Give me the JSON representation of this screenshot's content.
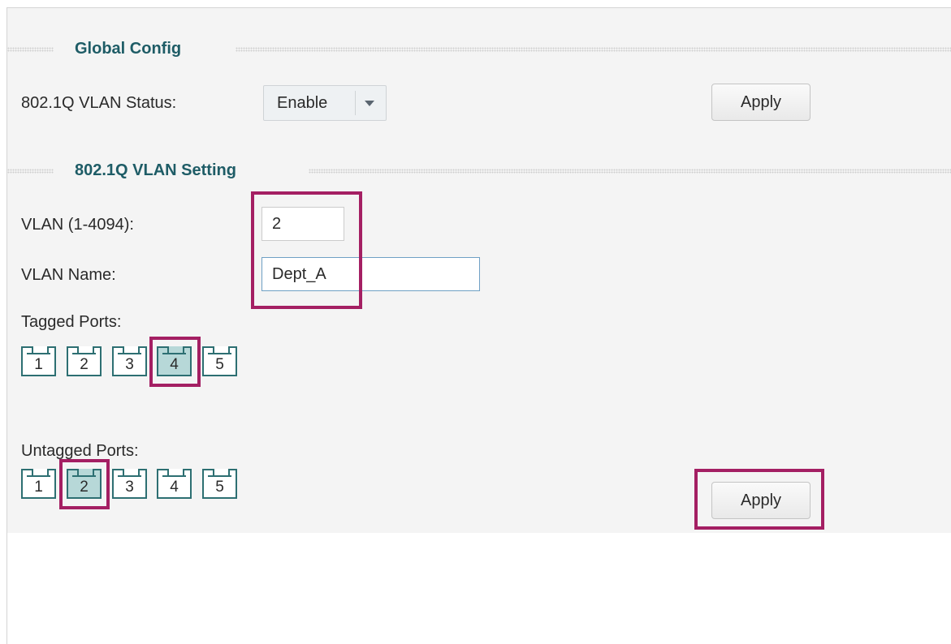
{
  "global_config": {
    "title": "Global Config",
    "status_label": "802.1Q VLAN Status:",
    "status_value": "Enable",
    "apply_label": "Apply"
  },
  "vlan_setting": {
    "title": "802.1Q VLAN Setting",
    "vlan_id_label": "VLAN (1-4094):",
    "vlan_id_value": "2",
    "vlan_name_label": "VLAN Name:",
    "vlan_name_value": "Dept_A",
    "tagged_label": "Tagged Ports:",
    "untagged_label": "Untagged Ports:",
    "tagged_ports": [
      {
        "num": "1",
        "selected": false
      },
      {
        "num": "2",
        "selected": false
      },
      {
        "num": "3",
        "selected": false
      },
      {
        "num": "4",
        "selected": true
      },
      {
        "num": "5",
        "selected": false
      }
    ],
    "untagged_ports": [
      {
        "num": "1",
        "selected": false
      },
      {
        "num": "2",
        "selected": true
      },
      {
        "num": "3",
        "selected": false
      },
      {
        "num": "4",
        "selected": false
      },
      {
        "num": "5",
        "selected": false
      }
    ],
    "apply_label": "Apply"
  },
  "colors": {
    "section_title": "#1e5c66",
    "highlight": "#a41f63",
    "port_border": "#2d6f72",
    "port_selected_fill": "#b7d8d8"
  },
  "icons": {
    "dropdown": "chevron-down-icon",
    "port": "ethernet-port-icon"
  }
}
